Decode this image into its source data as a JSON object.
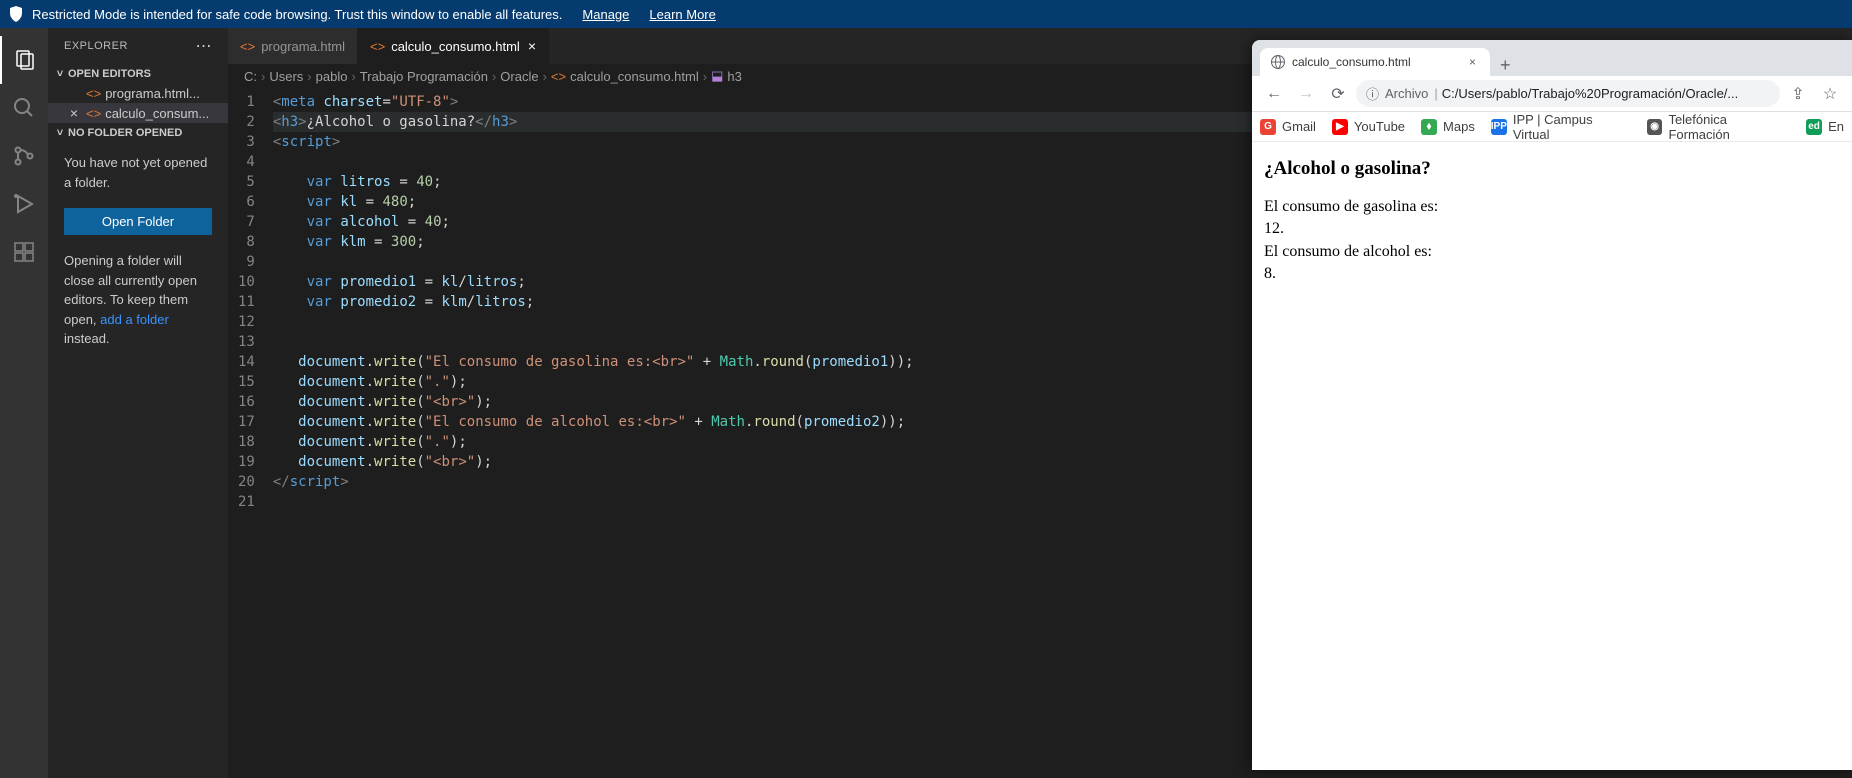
{
  "banner": {
    "text": "Restricted Mode is intended for safe code browsing. Trust this window to enable all features.",
    "manage": "Manage",
    "learn": "Learn More"
  },
  "sidebar": {
    "title": "EXPLORER",
    "sections": {
      "openEditors": "OPEN EDITORS",
      "noFolder": "NO FOLDER OPENED"
    },
    "editors": [
      {
        "name": "programa.html...",
        "active": false
      },
      {
        "name": "calculo_consum...",
        "active": true
      }
    ],
    "msg1": "You have not yet opened a folder.",
    "openFolderBtn": "Open Folder",
    "msg2a": "Opening a folder will close all currently open editors. To keep them open, ",
    "msg2link": "add a folder",
    "msg2b": " instead."
  },
  "tabs": [
    {
      "name": "programa.html",
      "active": false
    },
    {
      "name": "calculo_consumo.html",
      "active": true
    }
  ],
  "breadcrumb": {
    "parts": [
      "C:",
      "Users",
      "pablo",
      "Trabajo Programación",
      "Oracle"
    ],
    "file": "calculo_consumo.html",
    "symbol": "h3"
  },
  "code": {
    "lineCount": 21
  },
  "browser": {
    "tabTitle": "calculo_consumo.html",
    "addrProto": "Archivo",
    "addrUrl": "C:/Users/pablo/Trabajo%20Programación/Oracle/...",
    "bookmarks": [
      {
        "name": "Gmail",
        "color": "#ea4335",
        "ch": "G"
      },
      {
        "name": "YouTube",
        "color": "#ff0000",
        "ch": "▶"
      },
      {
        "name": "Maps",
        "color": "#34a853",
        "ch": "⬧"
      },
      {
        "name": "IPP | Campus Virtual",
        "color": "#1a73e8",
        "ch": "IPP"
      },
      {
        "name": "Telefónica Formación",
        "color": "#555",
        "ch": "◉"
      },
      {
        "name": "En",
        "color": "#0f9d58",
        "ch": "ed"
      }
    ],
    "page": {
      "heading": "¿Alcohol o gasolina?",
      "l1": "El consumo de gasolina es:",
      "l2": "12.",
      "l3": "El consumo de alcohol es:",
      "l4": "8."
    }
  }
}
